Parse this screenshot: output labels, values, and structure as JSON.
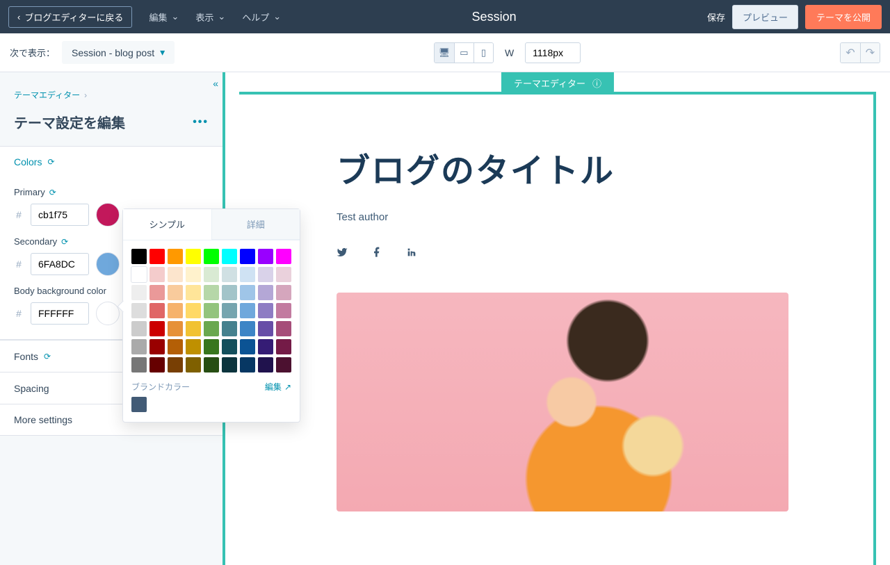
{
  "topbar": {
    "back": "ブログエディターに戻る",
    "menus": {
      "edit": "編集",
      "view": "表示",
      "help": "ヘルプ"
    },
    "title": "Session",
    "save": "保存",
    "preview": "プレビュー",
    "publish": "テーマを公開"
  },
  "secondbar": {
    "show_on_label": "次で表示：",
    "show_on_value": "Session - blog post",
    "width_label": "W",
    "width_value": "1118px"
  },
  "sidebar": {
    "breadcrumb": "テーマエディター",
    "title": "テーマ設定を編集",
    "sections": {
      "colors": {
        "label": "Colors",
        "primary": {
          "label": "Primary",
          "hex": "cb1f75"
        },
        "secondary": {
          "label": "Secondary",
          "hex": "6FA8DC"
        },
        "body_bg": {
          "label": "Body background color",
          "hex": "FFFFFF"
        }
      },
      "fonts": {
        "label": "Fonts"
      },
      "spacing": {
        "label": "Spacing"
      },
      "more": {
        "label": "More settings"
      }
    }
  },
  "popover": {
    "tab_simple": "シンプル",
    "tab_detail": "詳細",
    "brand_label": "ブランドカラー",
    "brand_edit": "編集",
    "brand_swatch": "#425b76",
    "rows": [
      [
        "#000000",
        "#ff0000",
        "#ff9900",
        "#ffff00",
        "#00ff00",
        "#00ffff",
        "#0000ff",
        "#9900ff",
        "#ff00ff"
      ],
      [
        "#ffffff",
        "#f4cccc",
        "#fce5cd",
        "#fff2cc",
        "#d9ead3",
        "#d0e0e3",
        "#cfe2f3",
        "#d9d2e9",
        "#ead1dc"
      ],
      [
        "#eeeeee",
        "#ea9999",
        "#f9cb9c",
        "#ffe599",
        "#b6d7a8",
        "#a2c4c9",
        "#9fc5e8",
        "#b4a7d6",
        "#d5a6bd"
      ],
      [
        "#dddddd",
        "#e06666",
        "#f6b26b",
        "#ffd966",
        "#93c47d",
        "#76a5af",
        "#6fa8dc",
        "#8e7cc3",
        "#c27ba0"
      ],
      [
        "#cccccc",
        "#cc0000",
        "#e69138",
        "#f1c232",
        "#6aa84f",
        "#45818e",
        "#3d85c6",
        "#674ea7",
        "#a64d79"
      ],
      [
        "#aaaaaa",
        "#990000",
        "#b45f06",
        "#bf9000",
        "#38761d",
        "#134f5c",
        "#0b5394",
        "#351c75",
        "#741b47"
      ],
      [
        "#777777",
        "#660000",
        "#783f04",
        "#7f6000",
        "#274e13",
        "#0c343d",
        "#073763",
        "#20124d",
        "#4c1130"
      ]
    ]
  },
  "preview": {
    "label": "テーマエディター",
    "post_title": "ブログのタイトル",
    "author": "Test author"
  },
  "colors": {
    "primary_swatch": "#c2185b",
    "secondary_swatch": "#6fa8dc",
    "body_bg_swatch": "#ffffff"
  },
  "hash": "#"
}
